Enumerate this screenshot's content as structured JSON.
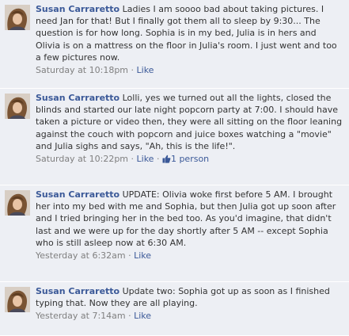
{
  "comments": [
    {
      "author": "Susan Carraretto",
      "text": "Ladies I am soooo bad about taking pictures. I need Jan for that! But I finally got them all to sleep by 9:30... The question is for how long. Sophia is in my bed, Julia is in hers and Olivia is on a mattress on the floor in Julia's room. I just went and too a few pictures now.",
      "time": "Saturday at 10:18pm",
      "separator": "·",
      "like": "Like"
    },
    {
      "author": "Susan Carraretto",
      "text": "Lolli, yes we turned out all the lights, closed the blinds and started our late night popcorn party at 7:00. I should have taken a picture or video then, they were all sitting on the floor leaning against the couch with popcorn and juice boxes watching a \"movie\" and Julia sighs and says, \"Ah, this is the life!\".",
      "time": "Saturday at 10:22pm",
      "separator": "·",
      "like": "Like",
      "like_count": "1 person"
    },
    {
      "author": "Susan Carraretto",
      "text": "UPDATE: Olivia woke first before 5 AM. I brought her into my bed with me and Sophia, but then Julia got up soon after and I tried bringing her in the bed too. As you'd imagine, that didn't last and we were up for the day shortly after 5 AM -- except Sophia who is still asleep now at 6:30 AM.",
      "time": "Yesterday at 6:32am",
      "separator": "·",
      "like": "Like"
    },
    {
      "author": "Susan Carraretto",
      "text": "Update two: Sophia got up as soon as I finished typing that. Now they are all playing.",
      "time": "Yesterday at 7:14am",
      "separator": "·",
      "like": "Like"
    }
  ],
  "icons": {
    "avatar": "profile-photo",
    "like_count": "thumbs-up-icon"
  },
  "colors": {
    "background": "#edeff4",
    "link": "#3b5998",
    "meta": "#808080",
    "text": "#333333"
  }
}
